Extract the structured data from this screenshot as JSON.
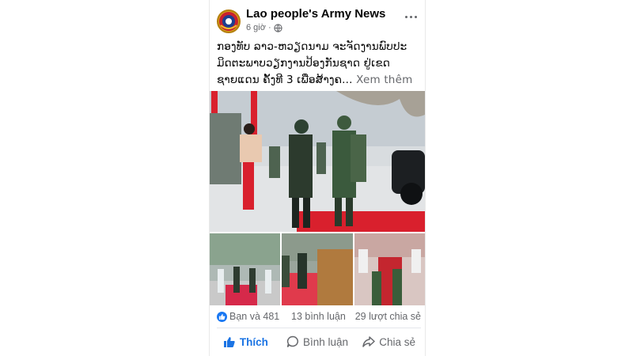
{
  "post": {
    "page_name": "Lao people's Army News",
    "time": "6 giờ ·",
    "caption": "ກອງທັບ ລາວ-ຫວຽດນາມ ຈະຈັດງານພົບປະ ມິດຕະພາບວຽກງານປ້ອງກັນຊາດ ຢູ່ເຂດ ຊາຍແດນ ຄັ້ງທີ 3 ເພື່ອສ້າງຄ...",
    "see_more": "Xem thêm"
  },
  "stats": {
    "reactions": "Bạn và 481",
    "comments": "13 bình luận",
    "shares": "29 lượt chia sẻ"
  },
  "actions": {
    "like": "Thích",
    "comment": "Bình luận",
    "share": "Chia sẻ"
  },
  "icons": {
    "avatar": "lao-army-emblem-icon",
    "privacy": "globe-icon",
    "more": "more-icon",
    "like": "thumbs-up-icon",
    "comment": "comment-icon",
    "share": "share-icon"
  },
  "colors": {
    "accent": "#1b74e4",
    "secondary_text": "#65676b",
    "primary_text": "#050505"
  }
}
